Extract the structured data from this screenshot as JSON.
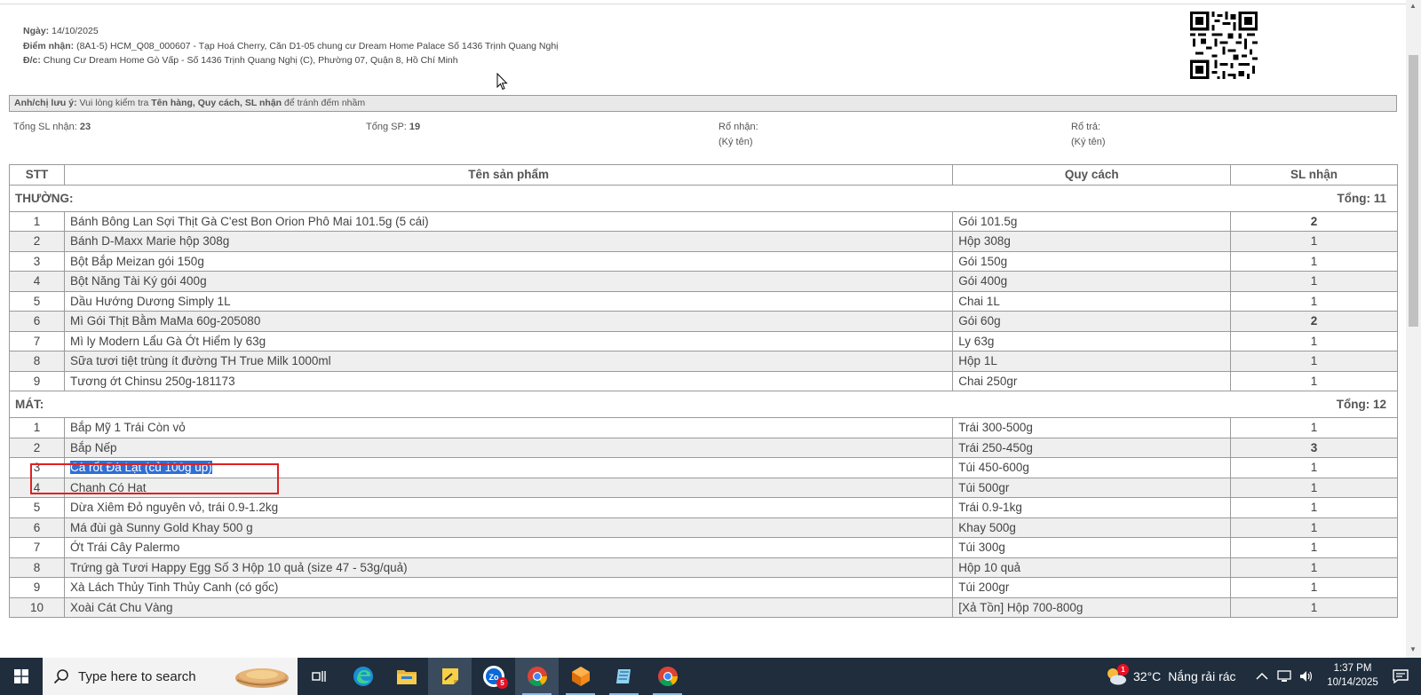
{
  "header": {
    "date_label": "Ngày:",
    "date_value": "14/10/2025",
    "pickup_label": "Điểm nhận:",
    "pickup_value": "(8A1-5) HCM_Q08_000607 - Tạp Hoá Cherry, Căn D1-05 chung cư Dream Home Palace Số 1436 Trịnh Quang Nghị",
    "address_label": "Đ/c:",
    "address_value": "Chung Cư Dream Home Gò Vấp - Số 1436 Trịnh Quang Nghị (C), Phường 07, Quận 8, Hồ Chí Minh"
  },
  "notice": {
    "label": "Anh/chị lưu ý:",
    "text_before": "Vui lòng kiểm tra",
    "emphasis": "Tên hàng, Quy cách, SL nhận",
    "text_after": "để tránh đếm nhầm"
  },
  "summary": {
    "total_received_label": "Tổng SL nhận:",
    "total_received_value": "23",
    "total_products_label": "Tổng SP:",
    "total_products_value": "19",
    "basket_in_label": "Rổ nhận:",
    "basket_in_sign": "(Ký tên)",
    "basket_out_label": "Rổ trả:",
    "basket_out_sign": "(Ký tên)"
  },
  "table": {
    "headers": {
      "stt": "STT",
      "name": "Tên sản phẩm",
      "spec": "Quy cách",
      "qty": "SL nhận"
    },
    "groups": [
      {
        "name": "THƯỜNG:",
        "total": "Tổng: 11",
        "rows": [
          {
            "stt": "1",
            "name": "Bánh Bông Lan Sợi Thịt Gà C'est Bon Orion Phô Mai 101.5g (5 cái)",
            "spec": "Gói 101.5g",
            "qty": "2",
            "bold": true
          },
          {
            "stt": "2",
            "name": "Bánh D-Maxx Marie hộp 308g",
            "spec": "Hộp 308g",
            "qty": "1"
          },
          {
            "stt": "3",
            "name": "Bột Bắp Meizan gói 150g",
            "spec": "Gói 150g",
            "qty": "1"
          },
          {
            "stt": "4",
            "name": "Bột Năng Tài Ký gói 400g",
            "spec": "Gói 400g",
            "qty": "1"
          },
          {
            "stt": "5",
            "name": "Dầu Hướng Dương Simply 1L",
            "spec": "Chai 1L",
            "qty": "1"
          },
          {
            "stt": "6",
            "name": "Mì Gói Thịt Bằm MaMa 60g-205080",
            "spec": "Gói 60g",
            "qty": "2",
            "bold": true
          },
          {
            "stt": "7",
            "name": "Mì ly Modern Lẩu Gà Ớt Hiểm ly 63g",
            "spec": "Ly 63g",
            "qty": "1"
          },
          {
            "stt": "8",
            "name": "Sữa tươi tiệt trùng ít đường TH True Milk 1000ml",
            "spec": "Hộp 1L",
            "qty": "1"
          },
          {
            "stt": "9",
            "name": "Tương ớt Chinsu 250g-181173",
            "spec": "Chai 250gr",
            "qty": "1"
          }
        ]
      },
      {
        "name": "MÁT:",
        "total": "Tổng: 12",
        "rows": [
          {
            "stt": "1",
            "name": "Bắp Mỹ 1 Trái Còn vỏ",
            "spec": "Trái 300-500g",
            "qty": "1"
          },
          {
            "stt": "2",
            "name": "Bắp Nếp",
            "spec": "Trái 250-450g",
            "qty": "3",
            "bold": true
          },
          {
            "stt": "3",
            "name": "Cà rốt Đà Lạt (củ 100g up)",
            "spec": "Túi 450-600g",
            "qty": "1",
            "selected": true
          },
          {
            "stt": "4",
            "name": "Chanh Có Hạt",
            "spec": "Túi 500gr",
            "qty": "1"
          },
          {
            "stt": "5",
            "name": "Dừa Xiêm Đỏ nguyên vỏ, trái 0.9-1.2kg",
            "spec": "Trái 0.9-1kg",
            "qty": "1"
          },
          {
            "stt": "6",
            "name": "Má đùi gà Sunny Gold Khay 500 g",
            "spec": "Khay 500g",
            "qty": "1"
          },
          {
            "stt": "7",
            "name": "Ớt Trái Cây Palermo",
            "spec": "Túi 300g",
            "qty": "1"
          },
          {
            "stt": "8",
            "name": "Trứng gà Tươi Happy Egg Số 3 Hộp 10 quả (size 47 - 53g/quả)",
            "spec": "Hộp 10 quả",
            "qty": "1"
          },
          {
            "stt": "9",
            "name": "Xà Lách Thủy Tinh Thủy Canh (có gốc)",
            "spec": "Túi 200gr",
            "qty": "1"
          },
          {
            "stt": "10",
            "name": "Xoài Cát Chu Vàng",
            "spec": "[Xả Tồn] Hộp 700-800g",
            "qty": "1"
          }
        ]
      }
    ]
  },
  "taskbar": {
    "search_placeholder": "Type here to search",
    "zalo_badge": "5",
    "weather_badge": "1",
    "weather_temp": "32°C",
    "weather_text": "Nắng rải rác",
    "time": "1:37 PM",
    "date": "10/14/2025"
  },
  "colors": {
    "selection": "#2f6fd6",
    "highlight_box": "#e02020",
    "taskbar": "#1f2d3d"
  },
  "icons": [
    "qr-code-icon",
    "mouse-cursor-icon",
    "windows-start-icon",
    "search-icon",
    "task-view-icon",
    "edge-icon",
    "file-explorer-icon",
    "sticky-notes-icon",
    "zalo-icon",
    "chrome-icon",
    "app-orange-icon",
    "app-notepad-icon",
    "chrome-2-icon",
    "weather-icon",
    "chevron-up-icon",
    "network-icon",
    "volume-icon",
    "notification-icon"
  ]
}
